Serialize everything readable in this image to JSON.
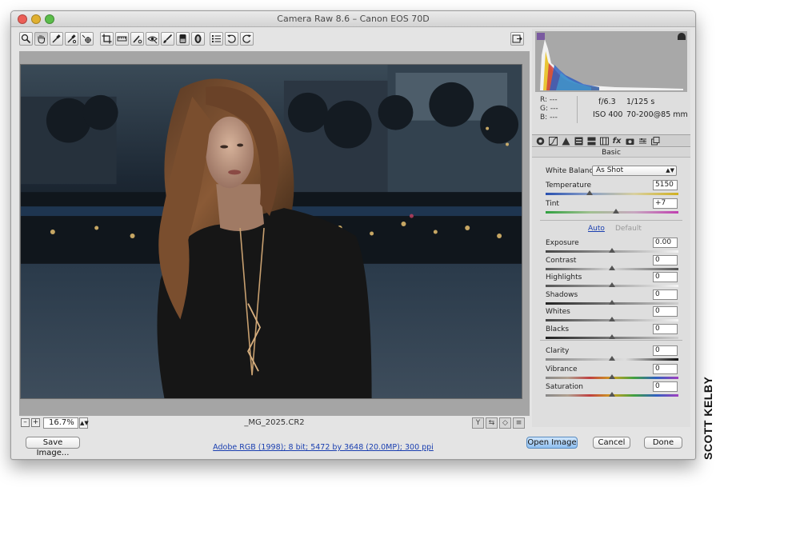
{
  "window": {
    "title": "Camera Raw 8.6  –  Canon EOS 70D"
  },
  "toolbar": {
    "tools": [
      {
        "name": "zoom-tool",
        "icon": "magnifier-icon"
      },
      {
        "name": "hand-tool",
        "icon": "hand-icon",
        "active": true
      },
      {
        "name": "white-balance-tool",
        "icon": "eyedropper-icon"
      },
      {
        "name": "color-sampler-tool",
        "icon": "color-sampler-icon"
      },
      {
        "name": "targeted-adjustment-tool",
        "icon": "target-adjust-icon"
      },
      {
        "name": "crop-tool",
        "icon": "crop-icon"
      },
      {
        "name": "straighten-tool",
        "icon": "straighten-icon"
      },
      {
        "name": "spot-removal-tool",
        "icon": "spot-removal-icon"
      },
      {
        "name": "red-eye-tool",
        "icon": "red-eye-icon"
      },
      {
        "name": "adjustment-brush-tool",
        "icon": "brush-icon"
      },
      {
        "name": "graduated-filter-tool",
        "icon": "graduated-filter-icon"
      },
      {
        "name": "radial-filter-tool",
        "icon": "radial-filter-icon"
      },
      {
        "name": "preferences-tool",
        "icon": "list-icon"
      },
      {
        "name": "rotate-left-tool",
        "icon": "rotate-ccw-icon"
      },
      {
        "name": "rotate-right-tool",
        "icon": "rotate-cw-icon"
      }
    ],
    "fullscreen_icon": "fullscreen-icon"
  },
  "preview": {
    "zoom": "16.7%",
    "filename": "_MG_2025.CR2"
  },
  "info": {
    "r_label": "R:",
    "r_value": "---",
    "g_label": "G:",
    "g_value": "---",
    "b_label": "B:",
    "b_value": "---",
    "aperture": "f/6.3",
    "shutter": "1/125 s",
    "iso": "ISO 400",
    "lens": "70-200@85 mm"
  },
  "panel": {
    "title": "Basic",
    "white_balance_label": "White Balance:",
    "white_balance_value": "As Shot",
    "temperature": {
      "label": "Temperature",
      "value": "5150",
      "position": 0.33
    },
    "tint": {
      "label": "Tint",
      "value": "+7",
      "position": 0.53
    },
    "auto_label": "Auto",
    "default_label": "Default",
    "tone": [
      {
        "label": "Exposure",
        "value": "0.00",
        "position": 0.5
      },
      {
        "label": "Contrast",
        "value": "0",
        "position": 0.5
      },
      {
        "label": "Highlights",
        "value": "0",
        "position": 0.5
      },
      {
        "label": "Shadows",
        "value": "0",
        "position": 0.5
      },
      {
        "label": "Whites",
        "value": "0",
        "position": 0.5
      },
      {
        "label": "Blacks",
        "value": "0",
        "position": 0.5
      }
    ],
    "presence": [
      {
        "label": "Clarity",
        "value": "0",
        "position": 0.5
      },
      {
        "label": "Vibrance",
        "value": "0",
        "position": 0.5
      },
      {
        "label": "Saturation",
        "value": "0",
        "position": 0.5
      }
    ]
  },
  "footer": {
    "save_label": "Save Image...",
    "workflow_link": "Adobe RGB (1998); 8 bit; 5472 by 3648 (20.0MP); 300 ppi",
    "open_label": "Open Image",
    "cancel_label": "Cancel",
    "done_label": "Done"
  },
  "credit": "SCOTT KELBY",
  "colors": {
    "open_button": "#8fbef0",
    "link": "#1a3fb0",
    "highlight_clip": "#2b2b2b",
    "shadow_clip": "#7a5aa0"
  }
}
